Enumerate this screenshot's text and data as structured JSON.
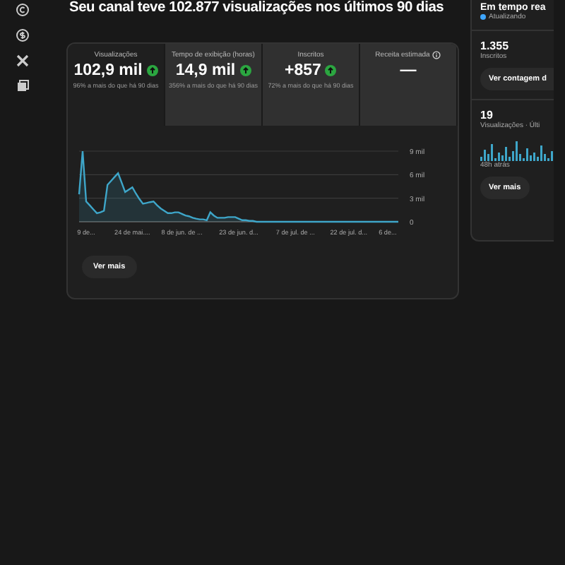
{
  "title": "Seu canal teve 102.877 visualizações nos últimos 90 dias",
  "metric_tabs": [
    {
      "label": "Visualizações",
      "value": "102,9 mil",
      "trend_up": true,
      "comparison": "96% a mais do que há 90 dias",
      "selected": true
    },
    {
      "label": "Tempo de exibição (horas)",
      "value": "14,9 mil",
      "trend_up": true,
      "comparison": "356% a mais do que há 90 dias",
      "selected": false
    },
    {
      "label": "Inscritos",
      "value": "+857",
      "trend_up": true,
      "comparison": "72% a mais do que há 90 dias",
      "selected": false
    },
    {
      "label": "Receita estimada",
      "value": "—",
      "trend_up": false,
      "info": true,
      "selected": false
    }
  ],
  "chart_data": {
    "type": "area",
    "categories": [
      null,
      null,
      "9 de...",
      null,
      null,
      null,
      null,
      null,
      null,
      null,
      null,
      null,
      null,
      null,
      null,
      "24 de mai....",
      null,
      null,
      null,
      null,
      null,
      null,
      null,
      null,
      null,
      null,
      null,
      null,
      null,
      "8 de jun. de ...",
      null,
      null,
      null,
      null,
      null,
      null,
      null,
      null,
      null,
      null,
      null,
      null,
      null,
      null,
      null,
      "23 de jun. d...",
      null,
      null,
      null,
      null,
      null,
      null,
      null,
      null,
      null,
      null,
      null,
      null,
      null,
      null,
      null,
      "7 de jul. de ...",
      null,
      null,
      null,
      null,
      null,
      null,
      null,
      null,
      null,
      null,
      null,
      null,
      null,
      null,
      "22 de jul. d...",
      null,
      null,
      null,
      null,
      null,
      null,
      null,
      null,
      null,
      null,
      "6 de...",
      null,
      null,
      null
    ],
    "series": [
      {
        "color": "#3ea6c9",
        "values": [
          3.5,
          9,
          2.6,
          2.1,
          1.6,
          1.1,
          1.2,
          1.4,
          4.7,
          5.2,
          5.7,
          6.2,
          5,
          3.8,
          4.1,
          4.4,
          3.6,
          2.9,
          2.3,
          2.4,
          2.5,
          2.6,
          2.1,
          1.7,
          1.4,
          1.1,
          1.1,
          1.2,
          1.2,
          1,
          0.8,
          0.7,
          0.5,
          0.4,
          0.3,
          0.3,
          0.2,
          1.2,
          0.8,
          0.5,
          0.5,
          0.5,
          0.6,
          0.6,
          0.6,
          0.4,
          0.2,
          0.2,
          0.1,
          0.1,
          0,
          0,
          0,
          0,
          0,
          0,
          0,
          0,
          0,
          0,
          0,
          0,
          0,
          0,
          0,
          0,
          0,
          0,
          0,
          0,
          0,
          0,
          0,
          0,
          0,
          0,
          0,
          0,
          0,
          0,
          0,
          0,
          0,
          0,
          0,
          0,
          0,
          0,
          0,
          0,
          0
        ]
      }
    ],
    "ylim": [
      0,
      9
    ],
    "yticks": [
      {
        "value": 0,
        "label": "0"
      },
      {
        "value": 3,
        "label": "3 mil"
      },
      {
        "value": 6,
        "label": "6 mil"
      },
      {
        "value": 9,
        "label": "9 mil"
      }
    ]
  },
  "more_button": "Ver mais",
  "realtime": {
    "title": "Em tempo rea",
    "status": "Atualizando",
    "subscribers": "1.355",
    "subscribers_label": "Inscritos",
    "subscribers_button": "Ver contagem d",
    "views": "19",
    "views_label": "Visualizações · Últi",
    "ago": "48h atrás",
    "more_button": "Ver mais"
  }
}
